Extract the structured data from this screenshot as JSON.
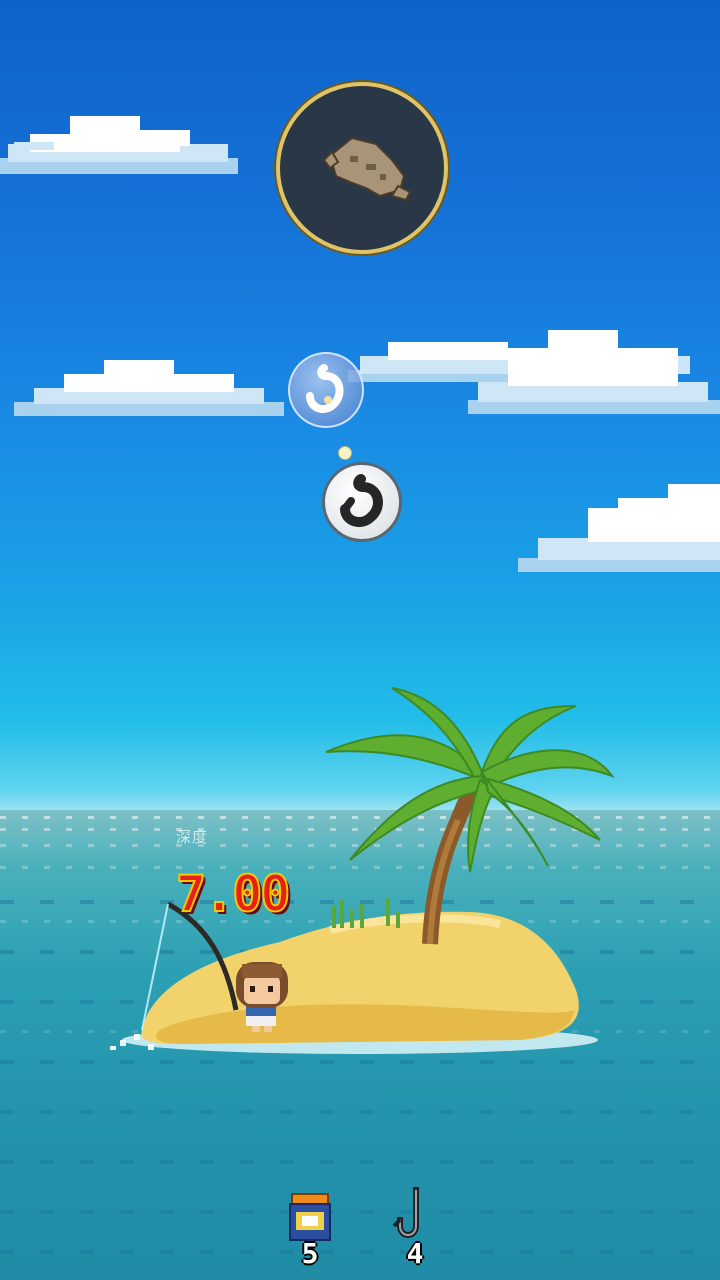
{
  "scene": {
    "type": "fishing-game",
    "sky_color": "#1a8ae4",
    "sea_color": "#2394ad"
  },
  "catch_display": {
    "icon": "fossil-skull-icon",
    "ring_color": "#e0c46a"
  },
  "hook_indicators": [
    {
      "icon": "silver-hook-icon"
    },
    {
      "icon": "dark-hook-icon"
    }
  ],
  "depth": {
    "label": "深度",
    "value": "7.00"
  },
  "hud": {
    "bait_icon": "bait-can-icon",
    "bait_count": "5",
    "hook_icon": "fishing-hook-icon",
    "hook_count": "4"
  }
}
